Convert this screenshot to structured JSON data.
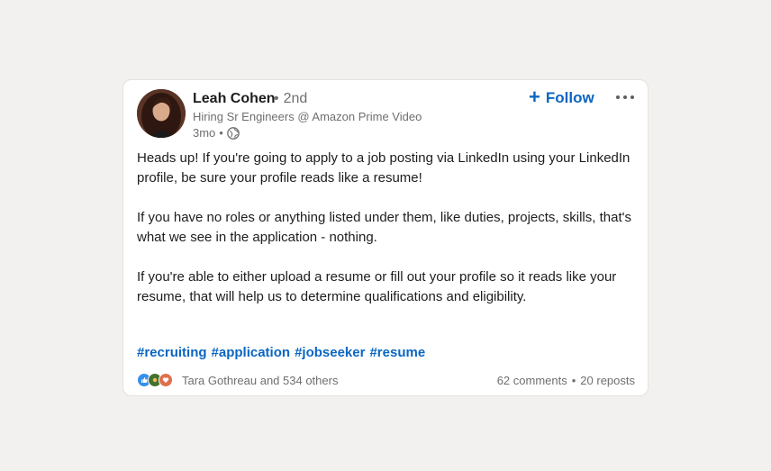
{
  "post": {
    "author": {
      "name": "Leah Cohen",
      "connection_degree": "2nd",
      "headline": "Hiring Sr Engineers @ Amazon Prime Video",
      "time_ago": "3mo",
      "visibility_icon": "globe-icon"
    },
    "follow_label": "Follow",
    "follow_icon": "plus-icon",
    "more_icon": "more-horizontal-icon",
    "paragraphs": [
      "Heads up! If you're going to apply to a job posting via LinkedIn using your LinkedIn profile, be sure your profile reads like a resume!",
      "If you have no roles or anything listed under them, like duties, projects, skills, that's what we see in the application - nothing.",
      "If you're able to either upload a resume or fill out your profile so it reads like your resume, that will help us to determine qualifications and eligibility."
    ],
    "hashtags": [
      "#recruiting",
      "#application",
      "#jobseeker",
      "#resume"
    ],
    "reactions": {
      "icons": [
        "like-icon",
        "celebrate-icon",
        "love-icon"
      ],
      "summary": "Tara Gothreau and 534 others"
    },
    "comments_label": "62 comments",
    "reposts_label": "20 reposts"
  },
  "colors": {
    "background": "#f2f1ef",
    "card": "#ffffff",
    "accent": "#0a66c2",
    "text_primary": "#1d1d1d",
    "text_secondary": "#6f6f6f"
  }
}
